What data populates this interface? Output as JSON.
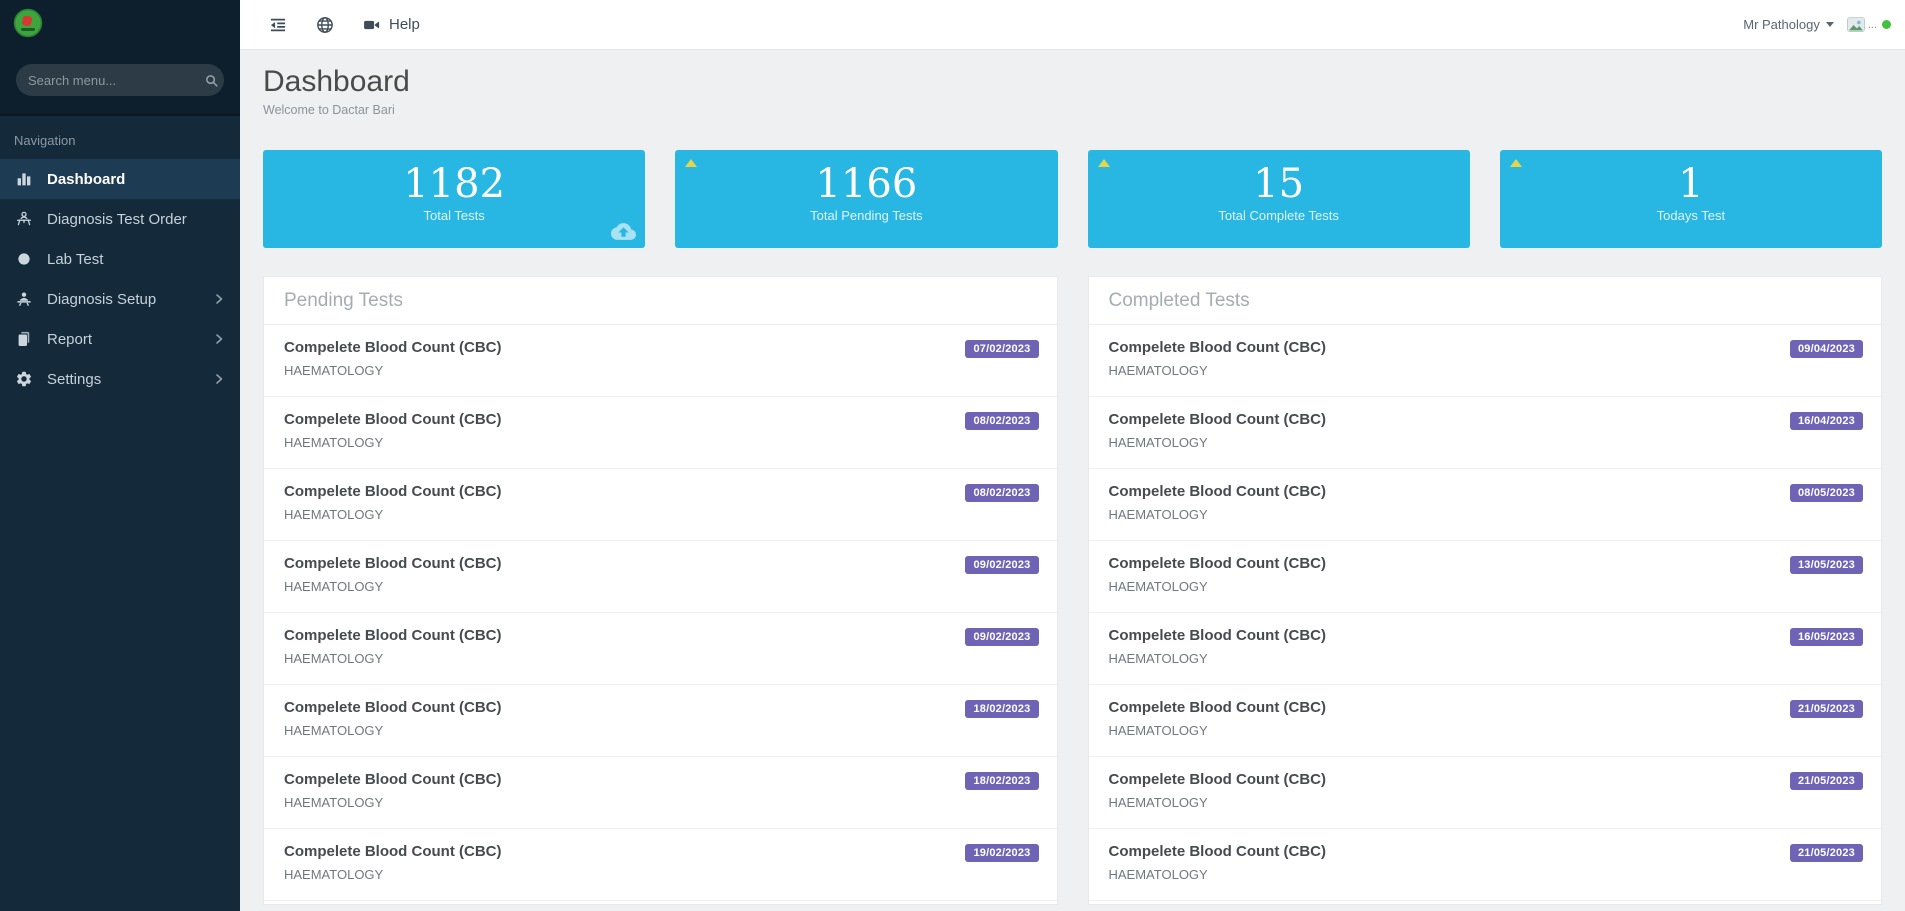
{
  "colors": {
    "accent_cyan": "#28b7e2",
    "badge_purple": "#6e63b5",
    "warning_yellow": "#e5d54c",
    "online_green": "#44c13c"
  },
  "sidebar": {
    "search_placeholder": "Search menu...",
    "section_label": "Navigation",
    "items": [
      {
        "label": "Dashboard",
        "icon": "bar-chart-icon",
        "active": true,
        "chevron": false
      },
      {
        "label": "Diagnosis Test Order",
        "icon": "user-desk-icon",
        "active": false,
        "chevron": false
      },
      {
        "label": "Lab Test",
        "icon": "circle-icon",
        "active": false,
        "chevron": false
      },
      {
        "label": "Diagnosis Setup",
        "icon": "user-setup-icon",
        "active": false,
        "chevron": true
      },
      {
        "label": "Report",
        "icon": "report-icon",
        "active": false,
        "chevron": true
      },
      {
        "label": "Settings",
        "icon": "gear-icon",
        "active": false,
        "chevron": true
      }
    ]
  },
  "topbar": {
    "help_label": "Help",
    "user_menu_label": "Mr Pathology",
    "avatar_ellipsis": "..."
  },
  "page_header": {
    "title": "Dashboard",
    "subtitle": "Welcome to Dactar Bari"
  },
  "stat_cards": [
    {
      "value": "1182",
      "label": "Total Tests",
      "has_warning_triangle": false,
      "has_cloud_icon": true
    },
    {
      "value": "1166",
      "label": "Total Pending Tests",
      "has_warning_triangle": true,
      "has_cloud_icon": false
    },
    {
      "value": "15",
      "label": "Total Complete Tests",
      "has_warning_triangle": true,
      "has_cloud_icon": false
    },
    {
      "value": "1",
      "label": "Todays Test",
      "has_warning_triangle": true,
      "has_cloud_icon": false
    }
  ],
  "panels": [
    {
      "title": "Pending Tests",
      "rows": [
        {
          "test_name": "Compelete Blood Count (CBC)",
          "category": "HAEMATOLOGY",
          "date": "07/02/2023"
        },
        {
          "test_name": "Compelete Blood Count (CBC)",
          "category": "HAEMATOLOGY",
          "date": "08/02/2023"
        },
        {
          "test_name": "Compelete Blood Count (CBC)",
          "category": "HAEMATOLOGY",
          "date": "08/02/2023"
        },
        {
          "test_name": "Compelete Blood Count (CBC)",
          "category": "HAEMATOLOGY",
          "date": "09/02/2023"
        },
        {
          "test_name": "Compelete Blood Count (CBC)",
          "category": "HAEMATOLOGY",
          "date": "09/02/2023"
        },
        {
          "test_name": "Compelete Blood Count (CBC)",
          "category": "HAEMATOLOGY",
          "date": "18/02/2023"
        },
        {
          "test_name": "Compelete Blood Count (CBC)",
          "category": "HAEMATOLOGY",
          "date": "18/02/2023"
        },
        {
          "test_name": "Compelete Blood Count (CBC)",
          "category": "HAEMATOLOGY",
          "date": "19/02/2023"
        }
      ]
    },
    {
      "title": "Completed Tests",
      "rows": [
        {
          "test_name": "Compelete Blood Count (CBC)",
          "category": "HAEMATOLOGY",
          "date": "09/04/2023"
        },
        {
          "test_name": "Compelete Blood Count (CBC)",
          "category": "HAEMATOLOGY",
          "date": "16/04/2023"
        },
        {
          "test_name": "Compelete Blood Count (CBC)",
          "category": "HAEMATOLOGY",
          "date": "08/05/2023"
        },
        {
          "test_name": "Compelete Blood Count (CBC)",
          "category": "HAEMATOLOGY",
          "date": "13/05/2023"
        },
        {
          "test_name": "Compelete Blood Count (CBC)",
          "category": "HAEMATOLOGY",
          "date": "16/05/2023"
        },
        {
          "test_name": "Compelete Blood Count (CBC)",
          "category": "HAEMATOLOGY",
          "date": "21/05/2023"
        },
        {
          "test_name": "Compelete Blood Count (CBC)",
          "category": "HAEMATOLOGY",
          "date": "21/05/2023"
        },
        {
          "test_name": "Compelete Blood Count (CBC)",
          "category": "HAEMATOLOGY",
          "date": "21/05/2023"
        }
      ]
    }
  ]
}
